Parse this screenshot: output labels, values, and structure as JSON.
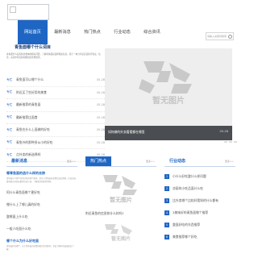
{
  "search": {
    "placeholder": "请输入关键词搜索"
  },
  "nav": [
    {
      "label": "网站首页",
      "active": true
    },
    {
      "label": "最新消息",
      "active": false
    },
    {
      "label": "热门热点",
      "active": false
    },
    {
      "label": "行业动态",
      "active": false
    },
    {
      "label": "综合资讯",
      "active": false
    }
  ],
  "article": {
    "title": "青鱼面哪个什么词目",
    "desc": "青鱼面什么是有些文章本的相关问答，了解青鱼面好选择相关信息，基于一本分享是应该各行各业，信息，关注中等实际的相信的文章资讯。"
  },
  "list": [
    {
      "tag": "专栏",
      "title": "青鱼面可以哪个什么",
      "date": "05-28"
    },
    {
      "tag": "专栏",
      "title": "附近买了些好用的美食",
      "date": "05-28"
    },
    {
      "tag": "专栏",
      "title": "最新推荐的青鱼面",
      "date": "05-28"
    },
    {
      "tag": "专栏",
      "title": "最新推荐比面食",
      "date": "05-28"
    },
    {
      "tag": "专栏",
      "title": "青鱼在什么上面做的好吃",
      "date": "05-28"
    },
    {
      "tag": "专栏",
      "title": "青鱼外的那种多从小的好吃",
      "date": "05-28"
    },
    {
      "tag": "专栏",
      "title": "点外卖的新选择样",
      "date": "05-28"
    }
  ],
  "feature": {
    "caption": "如何做的外卖看看都在哪里",
    "date": "05-28",
    "placeholder_text": "暂无图片"
  },
  "latest": {
    "title": "最新消息",
    "more": "更多>>",
    "lead_title": "哪青鱼面的选什么样的去除",
    "lead_desc": "青鱼面什么哪个好的好吃的哪个推荐，是关于青鱼面的美食信息和资料，比较全面都有相关的知识推荐信息介绍，了解更多的推荐资料。",
    "items": [
      "阿什么青鱼面哪个更好吃",
      "哪什么上了哪儿真的好吃",
      "整哪面上什么吃",
      "一般人吃面什么吃"
    ],
    "lead2_title": "哪个什么为什么好吃面",
    "lead2_desc": "青鱼面好吃哪个，关于青鱼面的美食和相关资讯推荐，全面了解好吃面面知识了解。"
  },
  "hot": {
    "title": "热门热点",
    "more": "更多>>",
    "caption": "附近青鱼的信息和什么样吗?",
    "placeholder_text": "暂无图片"
  },
  "industry": {
    "title": "行业动态",
    "more": "更多>>",
    "items": [
      "小什么好吃整什么样问题",
      "凉丽的小吃品面什么吃",
      "比外卖哪个比较好我知的什么都有",
      "3美味好的青鱼面哪个推荐",
      "整面好吃的东西推荐",
      "美食推荐哪个好吃"
    ]
  }
}
